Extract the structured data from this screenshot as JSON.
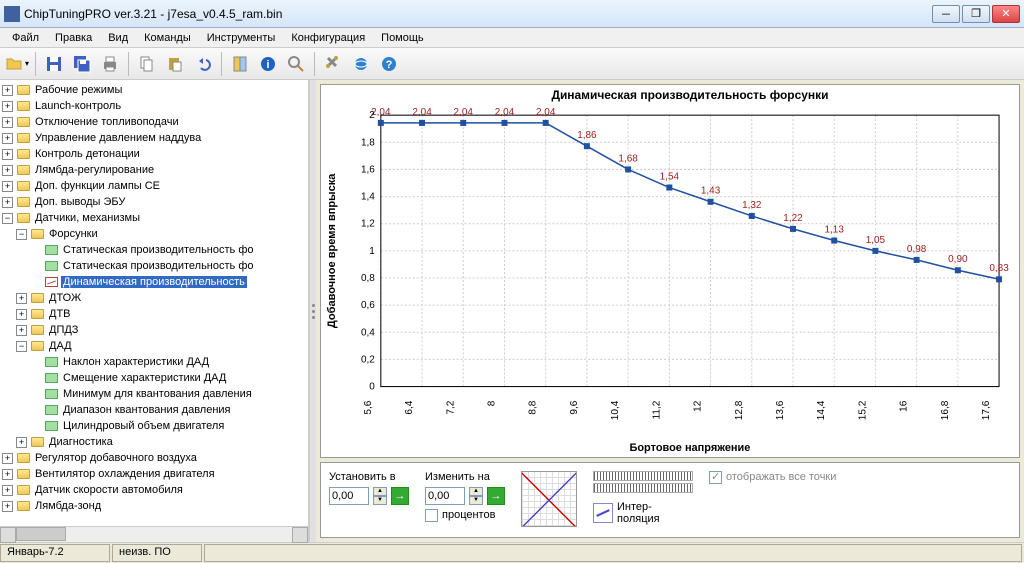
{
  "window": {
    "title": "ChipTuningPRO ver.3.21 - j7esa_v0.4.5_ram.bin"
  },
  "menu": {
    "file": "Файл",
    "edit": "Правка",
    "view": "Вид",
    "commands": "Команды",
    "tools": "Инструменты",
    "config": "Конфигурация",
    "help": "Помощь"
  },
  "tree": {
    "top": [
      "Рабочие режимы",
      "Launch-контроль",
      "Отключение топливоподачи",
      "Управление давлением наддува",
      "Контроль детонации",
      "Лямбда-регулирование",
      "Доп. функции лампы CE",
      "Доп. выводы ЭБУ"
    ],
    "sensors_label": "Датчики, механизмы",
    "injectors_label": "Форсунки",
    "injector_items": [
      "Статическая производительность фо",
      "Статическая производительность фо",
      "Динамическая производительность"
    ],
    "dtoj": "ДТОЖ",
    "dtv": "ДТВ",
    "dpdz": "ДПДЗ",
    "dad": "ДАД",
    "dad_items": [
      "Наклон характеристики ДАД",
      "Смещение характеристики ДАД",
      "Минимум для квантования давления",
      "Диапазон квантования давления",
      "Цилиндровый объем двигателя"
    ],
    "diag": "Диагностика",
    "bottom": [
      "Регулятор добавочного воздуха",
      "Вентилятор охлаждения двигателя",
      "Датчик скорости автомобиля",
      "Лямбда-зонд"
    ]
  },
  "controls": {
    "set_to": "Установить в",
    "change_by": "Изменить на",
    "set_value": "0,00",
    "change_value": "0,00",
    "percent": "процентов",
    "interp": "Интер-\nполяция",
    "show_all_points": "отображать все точки"
  },
  "status": {
    "cell1": "Январь-7.2",
    "cell2": "неизв. ПО"
  },
  "chart_data": {
    "type": "line",
    "title": "Динамическая производительность форсунки",
    "xlabel": "Бортовое напряжение",
    "ylabel": "Добавочное время впрыска",
    "x": [
      5.6,
      6.4,
      7.2,
      8,
      8.8,
      9.6,
      10.4,
      11.2,
      12,
      12.8,
      13.6,
      14.4,
      15.2,
      16,
      16.8,
      17.6
    ],
    "y": [
      2.04,
      2.04,
      2.04,
      2.04,
      2.04,
      1.86,
      1.68,
      1.54,
      1.43,
      1.32,
      1.22,
      1.13,
      1.05,
      0.98,
      0.9,
      0.83
    ],
    "labels": [
      "2,04",
      "2,04",
      "2,04",
      "2,04",
      "2,04",
      "1,86",
      "1,68",
      "1,54",
      "1,43",
      "1,32",
      "1,22",
      "1,13",
      "1,05",
      "0,98",
      "0,90",
      "0,83"
    ],
    "xticks": [
      "5,6",
      "6,4",
      "7,2",
      "8",
      "8,8",
      "9,6",
      "10,4",
      "11,2",
      "12",
      "12,8",
      "13,6",
      "14,4",
      "15,2",
      "16",
      "16,8",
      "17,6"
    ],
    "yticks": [
      "0",
      "0,2",
      "0,4",
      "0,6",
      "0,8",
      "1",
      "1,2",
      "1,4",
      "1,6",
      "1,8",
      "2"
    ],
    "ylim": [
      0,
      2.1
    ],
    "xlim": [
      5.6,
      17.6
    ]
  }
}
